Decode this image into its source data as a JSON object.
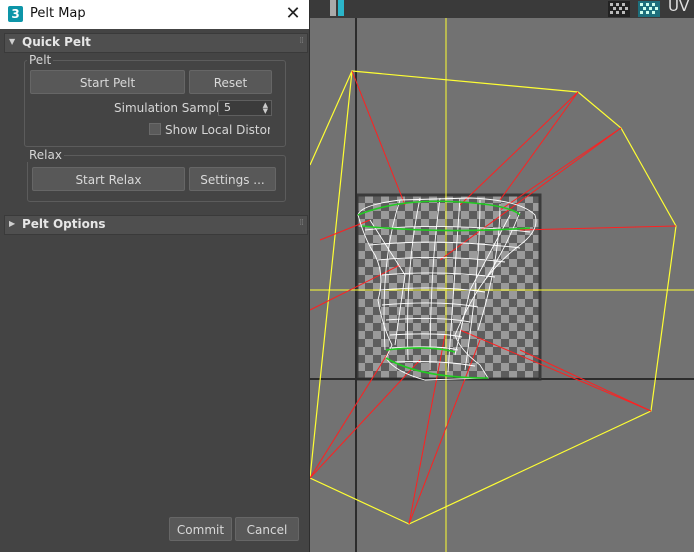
{
  "window": {
    "app_icon_text": "3",
    "title": "Pelt Map",
    "close_glyph": "✕"
  },
  "rollouts": {
    "quick_pelt": {
      "title": "Quick Pelt",
      "pelt_group": {
        "title": "Pelt",
        "start_pelt_label": "Start Pelt",
        "reset_label": "Reset",
        "simulation_samples_label": "Simulation Samples:",
        "simulation_samples_value": "5",
        "show_local_distortion_label": "Show Local Distortion",
        "show_local_distortion_checked": false
      },
      "relax_group": {
        "title": "Relax",
        "start_relax_label": "Start Relax",
        "settings_label": "Settings ..."
      }
    },
    "pelt_options": {
      "title": "Pelt Options"
    }
  },
  "footer": {
    "commit_label": "Commit",
    "cancel_label": "Cancel"
  },
  "viewport": {
    "toolbar_label": "UV",
    "icons": [
      "checker-icon",
      "checker-teal-icon"
    ],
    "colors": {
      "background": "#727272",
      "stretcher_lines": "#ffff33",
      "pelt_lines": "#ff1a1a",
      "mesh": "#ffffff",
      "seams": "#22cc22"
    }
  }
}
